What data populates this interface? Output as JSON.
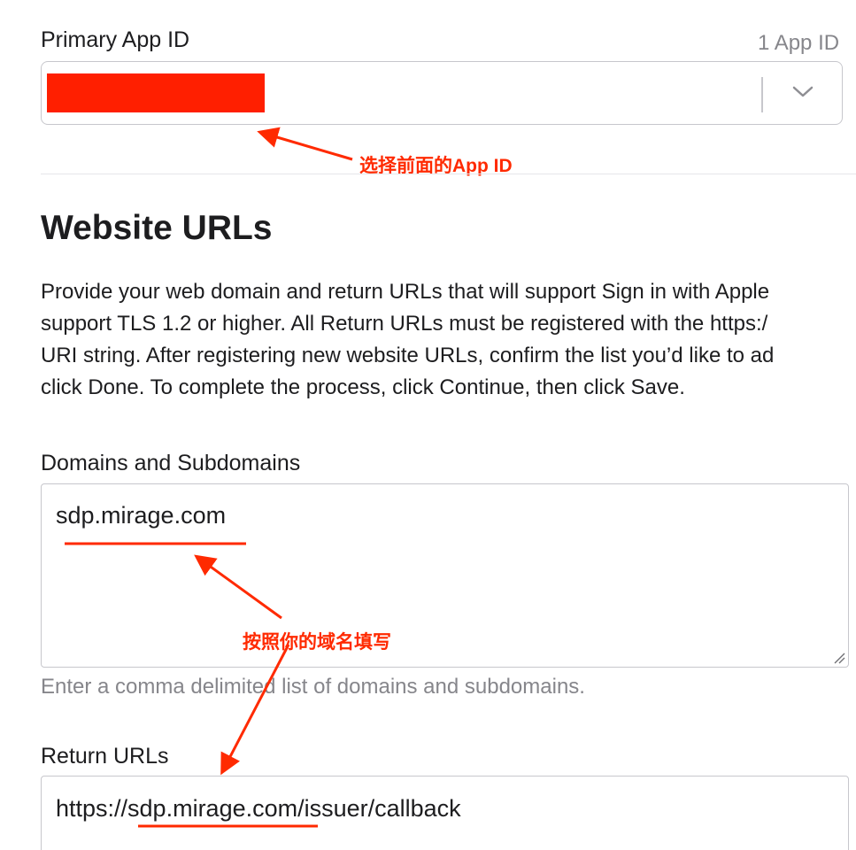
{
  "primary_app_id": {
    "label": "Primary App ID",
    "count": "1 App ID"
  },
  "annotations": {
    "select_app_id": "选择前面的App ID",
    "fill_domain": "按照你的域名填写"
  },
  "website_urls": {
    "title": "Website URLs",
    "description_lines": [
      "Provide your web domain and return URLs that will support Sign in with Apple",
      "support TLS 1.2 or higher. All Return URLs must be registered with the https:/",
      "URI string. After registering new website URLs, confirm the list you’d like to ad",
      "click Done. To complete the process, click Continue, then click Save."
    ]
  },
  "domains": {
    "label": "Domains and Subdomains",
    "value": "sdp.mirage.com",
    "hint": "Enter a comma delimited list of domains and subdomains."
  },
  "return_urls": {
    "label": "Return URLs",
    "value": "https://sdp.mirage.com/issuer/callback"
  },
  "colors": {
    "annotation": "#ff2a00",
    "redaction": "#ff1f00",
    "border": "#c7c7cc",
    "muted_text": "#86868b"
  }
}
